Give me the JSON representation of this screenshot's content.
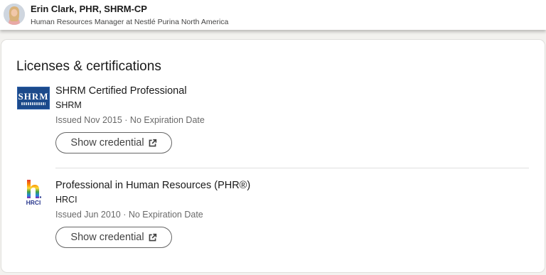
{
  "header": {
    "name": "Erin Clark, PHR, SHRM-CP",
    "headline": "Human Resources Manager at Nestlé Purina North America"
  },
  "section": {
    "title": "Licenses & certifications"
  },
  "certifications": [
    {
      "name": "SHRM Certified Professional",
      "issuer": "SHRM",
      "issued": "Issued Nov 2015 · No Expiration Date",
      "button_label": "Show credential",
      "logo": {
        "text": "SHRM",
        "icon": "shrm-logo",
        "color": "#1c4a8b"
      }
    },
    {
      "name": "Professional in Human Resources (PHR®)",
      "issuer": "HRCI",
      "issued": "Issued Jun 2010 · No Expiration Date",
      "button_label": "Show credential",
      "logo": {
        "text": "HRCI",
        "icon": "hrci-logo",
        "color": "#2b3a8f"
      }
    }
  ],
  "icons": {
    "button_icon": "external-link-icon"
  },
  "colors": {
    "page_background": "#f3f2ef",
    "card_background": "#ffffff",
    "button_border": "#666666"
  }
}
